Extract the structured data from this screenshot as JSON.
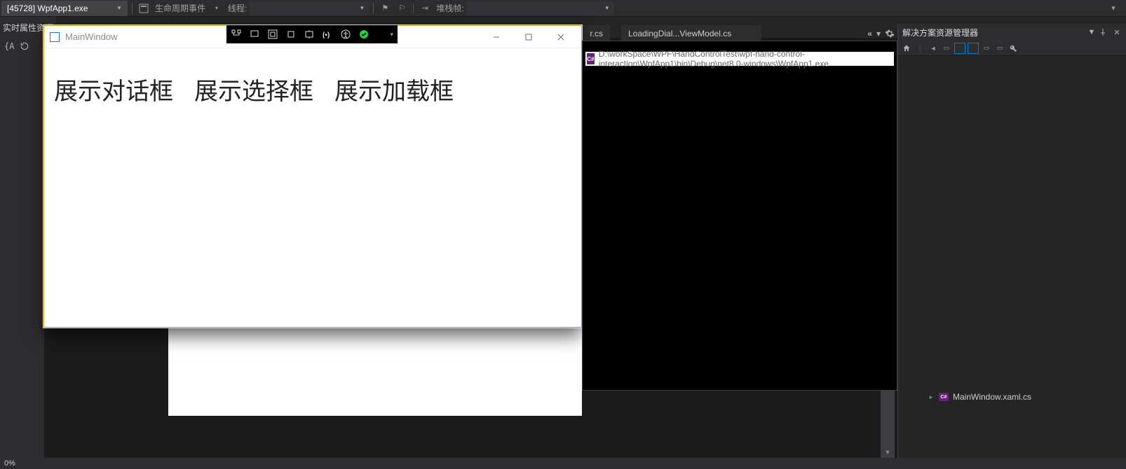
{
  "topbar": {
    "process_label": "[45728] WpfApp1.exe",
    "lifecycle_btn": "生命周期事件",
    "thread_label": "线程:",
    "stackframe_label": "堆栈帧:"
  },
  "left_strip": {
    "label": "实时属性资源"
  },
  "tabs": {
    "partial_suffix": "r.cs",
    "loading_viewmodel": "LoadingDial...ViewModel.cs"
  },
  "solution_explorer": {
    "title": "解决方案资源管理器",
    "tree_item": "MainWindow.xaml.cs"
  },
  "app_window": {
    "title": "MainWindow",
    "button_dialog": "展示对话框",
    "button_select": "展示选择框",
    "button_loading": "展示加载框"
  },
  "console": {
    "path": "D:\\workSpace\\WPF\\HandControlTest\\wpf-hand-control-interaction\\WpfApp1\\bin\\Debug\\net8.0-windows\\WpfApp1.exe",
    "cs_badge": "C#"
  },
  "status": {
    "left_text": "0%"
  }
}
